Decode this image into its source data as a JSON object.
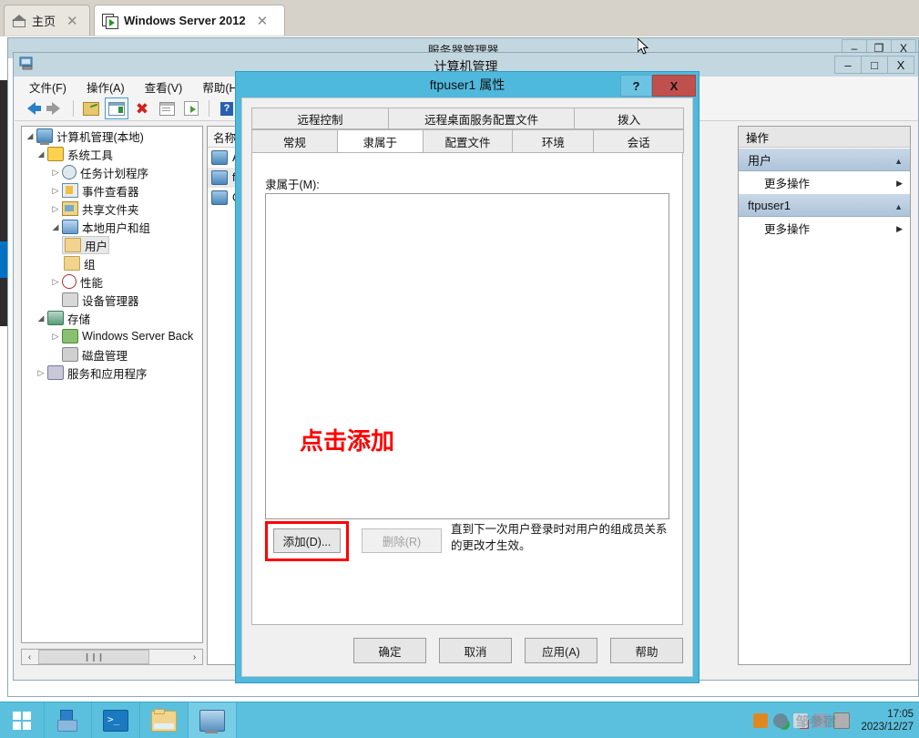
{
  "browser_tabs": [
    {
      "label": "主页",
      "icon": "home-icon",
      "active": false,
      "close": "✕"
    },
    {
      "label": "Windows Server 2012",
      "icon": "windows-server-icon",
      "active": true,
      "close": "✕"
    }
  ],
  "server_manager_window": {
    "title": "服务器管理器",
    "minimize": "–",
    "restore": "❐",
    "close": "X"
  },
  "computer_management_window": {
    "title": "计算机管理",
    "minimize": "–",
    "maximize": "□",
    "close": "X",
    "menu": [
      {
        "label": "文件(F)"
      },
      {
        "label": "操作(A)"
      },
      {
        "label": "查看(V)"
      },
      {
        "label": "帮助(H)"
      }
    ],
    "toolbar": [
      {
        "name": "back-arrow-icon"
      },
      {
        "name": "forward-arrow-icon"
      },
      {
        "name": "folder-up-icon"
      },
      {
        "name": "show-pane-icon"
      },
      {
        "name": "delete-icon"
      },
      {
        "name": "properties-icon"
      },
      {
        "name": "export-list-icon"
      },
      {
        "name": "help-icon"
      },
      {
        "name": "toggle-action-pane-icon"
      }
    ]
  },
  "tree": {
    "nodes": [
      {
        "label": "计算机管理(本地)",
        "indent": 0,
        "twisty": "open",
        "icon": "computer-icon",
        "selected": false
      },
      {
        "label": "系统工具",
        "indent": 1,
        "twisty": "open",
        "icon": "tools-icon",
        "selected": false
      },
      {
        "label": "任务计划程序",
        "indent": 2,
        "twisty": "closed",
        "icon": "clock-icon",
        "selected": false
      },
      {
        "label": "事件查看器",
        "indent": 2,
        "twisty": "closed",
        "icon": "event-viewer-icon",
        "selected": false
      },
      {
        "label": "共享文件夹",
        "indent": 2,
        "twisty": "closed",
        "icon": "shared-folder-icon",
        "selected": false
      },
      {
        "label": "本地用户和组",
        "indent": 2,
        "twisty": "open",
        "icon": "local-users-icon",
        "selected": false
      },
      {
        "label": "用户",
        "indent": 3,
        "twisty": "none",
        "icon": "folder-icon",
        "selected": true
      },
      {
        "label": "组",
        "indent": 3,
        "twisty": "none",
        "icon": "folder-icon",
        "selected": false
      },
      {
        "label": "性能",
        "indent": 2,
        "twisty": "closed",
        "icon": "performance-icon",
        "selected": false
      },
      {
        "label": "设备管理器",
        "indent": 2,
        "twisty": "none",
        "icon": "device-manager-icon",
        "selected": false
      },
      {
        "label": "存储",
        "indent": 1,
        "twisty": "open",
        "icon": "storage-icon",
        "selected": false
      },
      {
        "label": "Windows Server Back",
        "indent": 2,
        "twisty": "closed",
        "icon": "backup-icon",
        "selected": false
      },
      {
        "label": "磁盘管理",
        "indent": 2,
        "twisty": "none",
        "icon": "disk-icon",
        "selected": false
      },
      {
        "label": "服务和应用程序",
        "indent": 1,
        "twisty": "closed",
        "icon": "services-icon",
        "selected": false
      }
    ],
    "scrollbar": {
      "left_arrow": "‹",
      "right_arrow": "›",
      "grip": "❙❙❙"
    }
  },
  "list_pane": {
    "header": "名称",
    "rows": [
      {
        "label": "Adm"
      },
      {
        "label": "ftpu"
      },
      {
        "label": "Gue"
      }
    ]
  },
  "actions_pane": {
    "header": "操作",
    "groups": [
      {
        "title": "用户",
        "items": [
          {
            "label": "更多操作"
          }
        ]
      },
      {
        "title": "ftpuser1",
        "items": [
          {
            "label": "更多操作"
          }
        ]
      }
    ]
  },
  "dialog": {
    "title": "ftpuser1 属性",
    "help_button": "?",
    "close_button": "X",
    "tabs_row1": [
      {
        "label": "远程控制",
        "active": false
      },
      {
        "label": "远程桌面服务配置文件",
        "active": false
      },
      {
        "label": "拨入",
        "active": false
      }
    ],
    "tabs_row2": [
      {
        "label": "常规",
        "active": false
      },
      {
        "label": "隶属于",
        "active": true
      },
      {
        "label": "配置文件",
        "active": false
      },
      {
        "label": "环境",
        "active": false
      },
      {
        "label": "会话",
        "active": false
      }
    ],
    "field_label": "隶属于(M):",
    "list_items": [],
    "annotation": "点击添加",
    "annotation_color": "#ff0000",
    "add_button": "添加(D)...",
    "remove_button": "删除(R)",
    "remove_disabled": true,
    "hint": "直到下一次用户登录时对用户的组成员关系的更改才生效。",
    "footer_buttons": [
      {
        "label": "确定"
      },
      {
        "label": "取消"
      },
      {
        "label": "应用(A)"
      },
      {
        "label": "帮助"
      }
    ]
  },
  "taskbar": {
    "start": "windows-logo-icon",
    "items": [
      {
        "name": "server-manager-taskbar-icon",
        "active": false
      },
      {
        "name": "powershell-taskbar-icon",
        "active": false
      },
      {
        "name": "file-explorer-taskbar-icon",
        "active": false
      },
      {
        "name": "computer-management-taskbar-icon",
        "active": true
      }
    ],
    "tray": [
      {
        "name": "java-tray-icon",
        "color": "#e08820"
      },
      {
        "name": "usb-safe-remove-tray-icon",
        "color": "#2aa84a"
      },
      {
        "name": "network-error-tray-icon",
        "color": "#c04040"
      },
      {
        "name": "volume-muted-tray-icon",
        "color": "#5a7a9a"
      },
      {
        "name": "app-tray-icon",
        "color": "#9a9a9a"
      }
    ],
    "time": "17:05",
    "date": "2023/12/27",
    "watermark": "邹参宿"
  }
}
